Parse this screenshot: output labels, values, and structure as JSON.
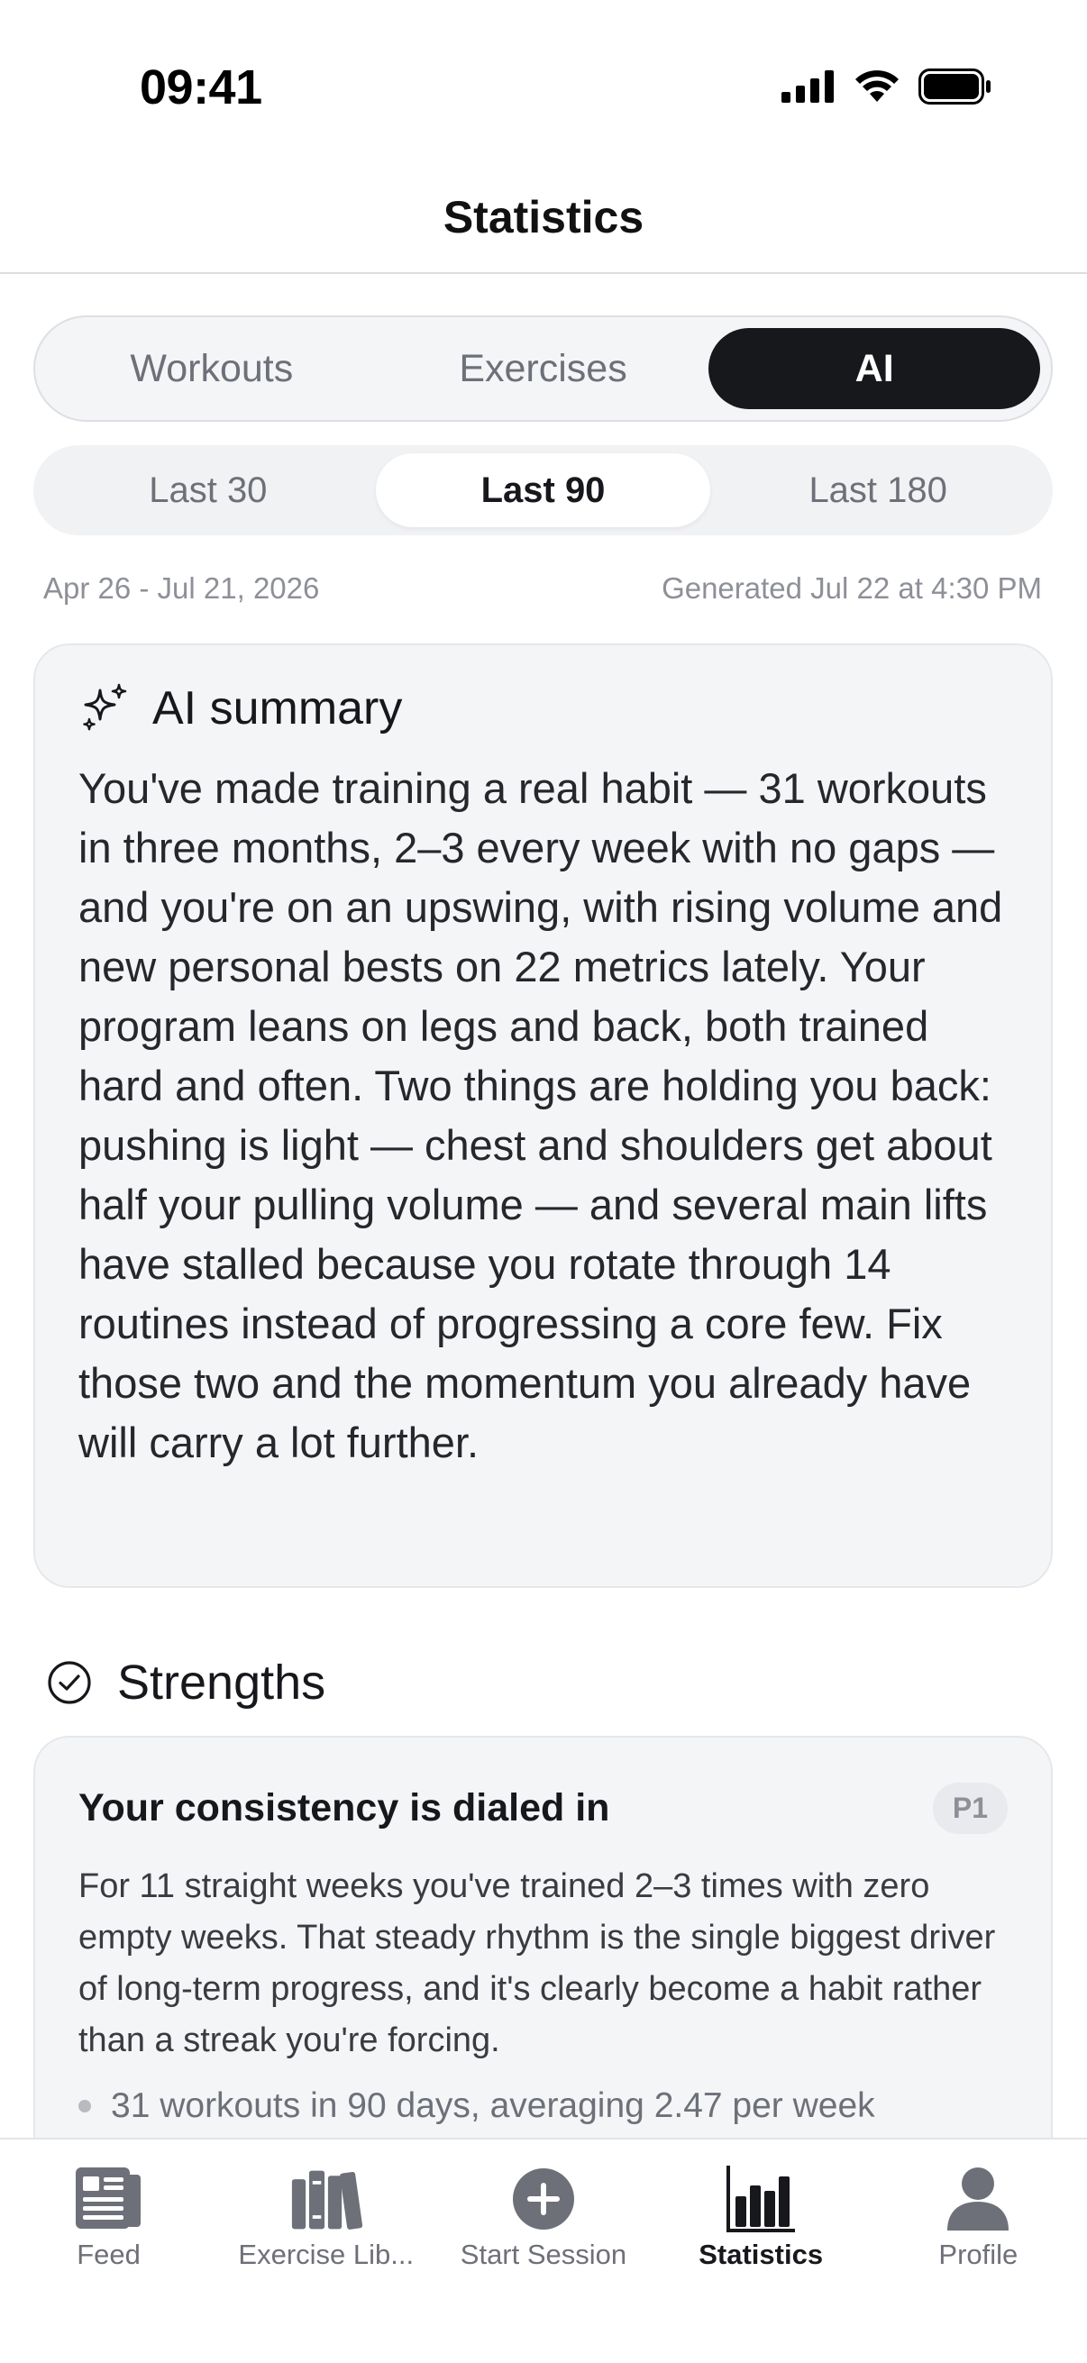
{
  "status_bar": {
    "time": "09:41"
  },
  "header": {
    "title": "Statistics"
  },
  "main_tabs": [
    {
      "label": "Workouts",
      "active": false
    },
    {
      "label": "Exercises",
      "active": false
    },
    {
      "label": "AI",
      "active": true
    }
  ],
  "range_tabs": [
    {
      "label": "Last 30",
      "active": false
    },
    {
      "label": "Last 90",
      "active": true
    },
    {
      "label": "Last 180",
      "active": false
    }
  ],
  "meta": {
    "date_range": "Apr 26 - Jul 21, 2026",
    "generated": "Generated Jul 22 at 4:30 PM"
  },
  "summary": {
    "title": "AI summary",
    "body": "You've made training a real habit — 31 workouts in three months, 2–3 every week with no gaps — and you're on an upswing, with rising volume and new personal bests on 22 metrics lately. Your program leans on legs and back, both trained hard and often. Two things are holding you back: pushing is light — chest and shoulders get about half your pulling volume — and several main lifts have stalled because you rotate through 14 routines instead of progressing a core few. Fix those two and the momentum you already have will carry a lot further."
  },
  "strengths": {
    "title": "Strengths",
    "items": [
      {
        "title": "Your consistency is dialed in",
        "priority": "P1",
        "body": "For 11 straight weeks you've trained 2–3 times with zero empty weeks. That steady rhythm is the single biggest driver of long-term progress, and it's clearly become a habit rather than a streak you're forcing.",
        "bullets": [
          "31 workouts in 90 days, averaging 2.47 per week"
        ]
      }
    ]
  },
  "tab_bar": [
    {
      "label": "Feed",
      "icon": "feed-icon",
      "active": false
    },
    {
      "label": "Exercise Lib...",
      "icon": "library-icon",
      "active": false
    },
    {
      "label": "Start Session",
      "icon": "plus-circle-icon",
      "active": false
    },
    {
      "label": "Statistics",
      "icon": "bar-chart-icon",
      "active": true
    },
    {
      "label": "Profile",
      "icon": "person-icon",
      "active": false
    }
  ],
  "colors": {
    "accent_dark": "#17181c",
    "muted_text": "#6e7079",
    "card_bg": "#f4f5f7"
  }
}
